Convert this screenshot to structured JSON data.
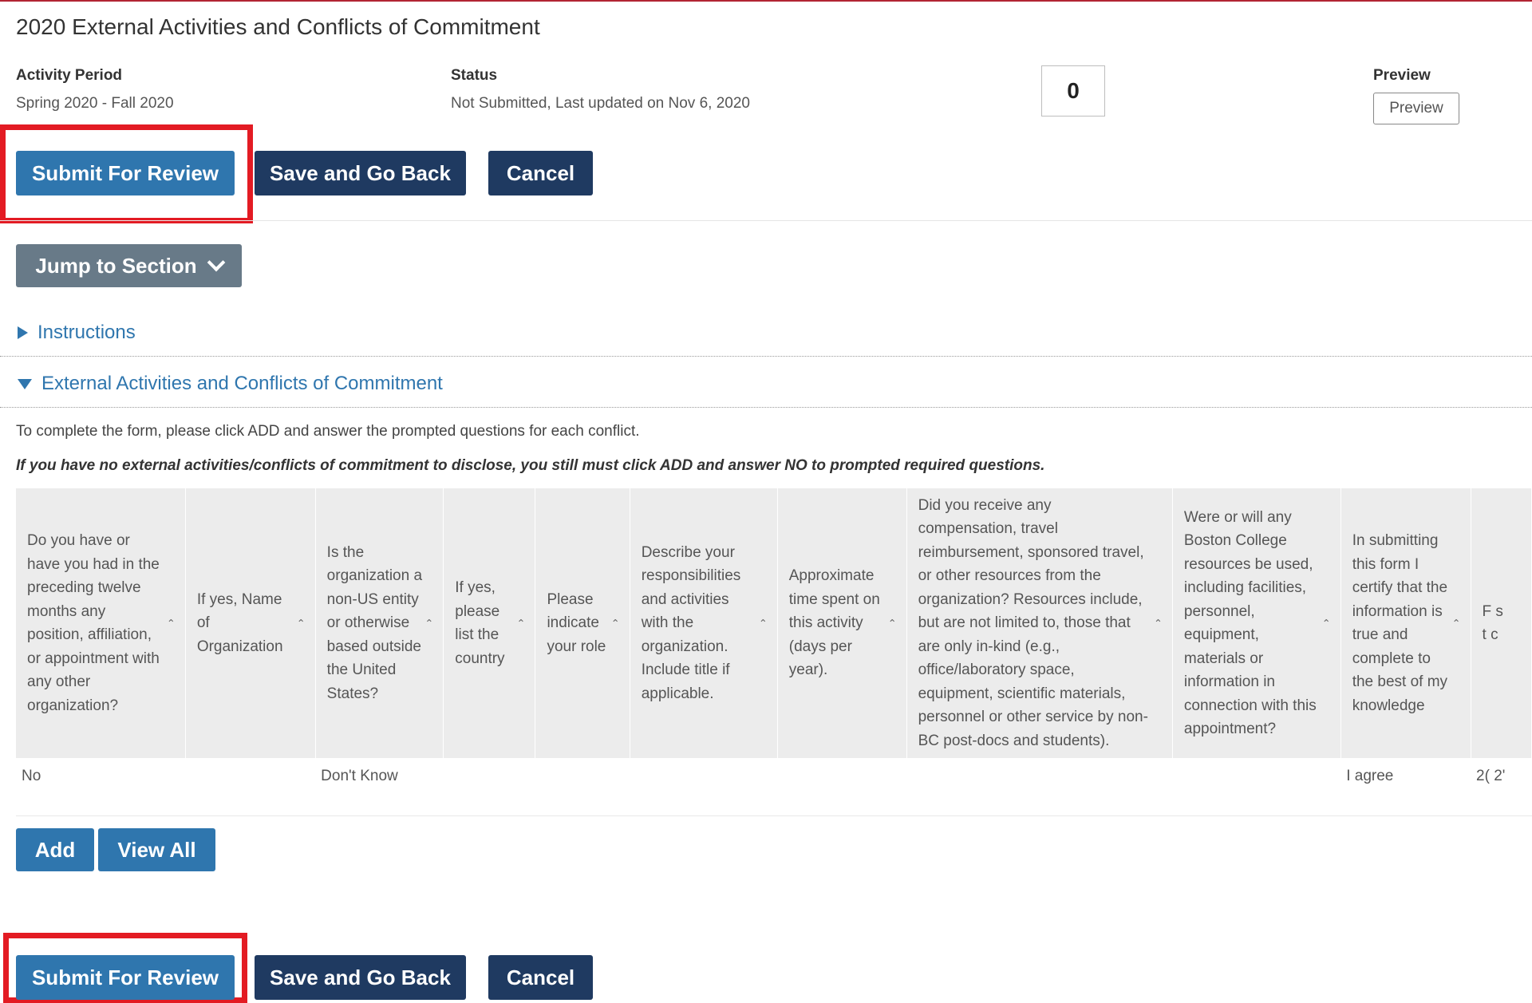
{
  "page": {
    "title": "2020 External Activities and Conflicts of Commitment"
  },
  "meta": {
    "activity_period_label": "Activity Period",
    "activity_period_value": "Spring 2020 - Fall 2020",
    "status_label": "Status",
    "status_value": "Not Submitted, Last updated on Nov 6, 2020",
    "count_value": "0",
    "preview_label": "Preview",
    "preview_button": "Preview"
  },
  "actions": {
    "submit": "Submit For Review",
    "save_back": "Save and Go Back",
    "cancel": "Cancel"
  },
  "jump": {
    "label": "Jump to Section"
  },
  "sections": {
    "instructions": "Instructions",
    "external": "External Activities and Conflicts of Commitment"
  },
  "info": {
    "line1": "To complete the form, please click ADD and answer the prompted questions for each conflict.",
    "line2": "If you have no external activities/conflicts of commitment to disclose, you still must click ADD and answer NO to prompted required questions."
  },
  "table": {
    "columns": [
      "Do you have or have you had in the preceding twelve months any position, affiliation, or appointment with any other organization?",
      "If yes, Name of Organization",
      "Is the organization a non-US entity or otherwise based outside the United States?",
      "If yes, please list the country",
      "Please indicate your role",
      "Describe your responsibilities and activities with the organization. Include title if applicable.",
      "Approximate time spent on this activity (days per year).",
      "Did you receive any compensation, travel reimbursement, sponsored travel, or other resources from the organization? Resources include, but are not limited to, those that are only in-kind (e.g., office/laboratory space, equipment, scientific materials, personnel or other service by non-BC post-docs and students).",
      "Were or will any Boston College resources be used, including facilities, personnel, equipment, materials or information in connection with this appointment?",
      "In submitting this form I certify that the information is true and complete to the best of my knowledge",
      "F s t c"
    ],
    "rows": [
      [
        "No",
        "",
        "Don't Know",
        "",
        "",
        "",
        "",
        "",
        "",
        "I agree",
        "2( 2'"
      ]
    ]
  },
  "table_actions": {
    "add": "Add",
    "view_all": "View All"
  },
  "colors": {
    "primary": "#2f76ae",
    "dark": "#1f3a61",
    "grey": "#687a88",
    "highlight": "#e31b23"
  }
}
